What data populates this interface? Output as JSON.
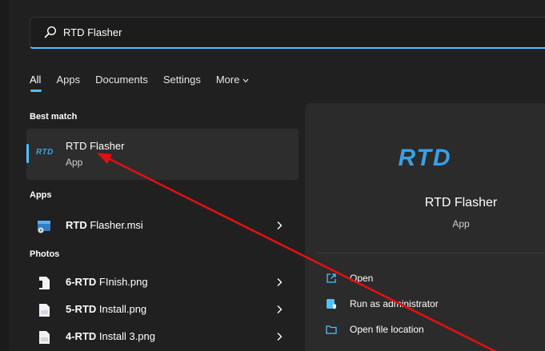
{
  "search": {
    "value": "RTD Flasher",
    "icon": "search-icon"
  },
  "tabs": [
    {
      "label": "All"
    },
    {
      "label": "Apps"
    },
    {
      "label": "Documents"
    },
    {
      "label": "Settings"
    },
    {
      "label": "More"
    }
  ],
  "sections": {
    "best_match": "Best match",
    "apps": "Apps",
    "photos": "Photos"
  },
  "best_match": {
    "logo_text": "RTD",
    "title": "RTD Flasher",
    "subtitle": "App"
  },
  "apps": [
    {
      "bold": "RTD",
      "rest": " Flasher.msi",
      "icon": "installer-icon"
    }
  ],
  "photos": [
    {
      "bold": "6-RTD",
      "rest": " FInish.png",
      "icon": "image-file-icon"
    },
    {
      "bold": "5-RTD",
      "rest": " Install.png",
      "icon": "image-file-icon"
    },
    {
      "bold": "4-RTD",
      "rest": " Install 3.png",
      "icon": "image-file-icon"
    }
  ],
  "preview": {
    "logo_text": "RTD",
    "title": "RTD Flasher",
    "subtitle": "App",
    "actions": [
      {
        "label": "Open",
        "icon": "open-icon"
      },
      {
        "label": "Run as administrator",
        "icon": "shield-admin-icon"
      },
      {
        "label": "Open file location",
        "icon": "folder-icon"
      }
    ]
  },
  "colors": {
    "accent": "#4cc2ff",
    "logo_blue": "#3aa0e8",
    "annotation_arrow": "#e01010"
  }
}
